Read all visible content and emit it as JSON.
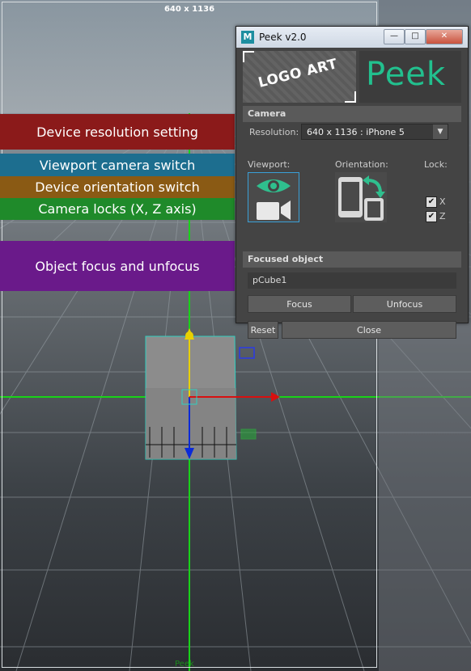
{
  "viewport": {
    "resolution_label": "640 x 1136",
    "bottom_label": "Peek",
    "object_name": "pCube1"
  },
  "annotations": [
    {
      "text": "Device resolution setting",
      "color": "#8b1a1a"
    },
    {
      "text": "Viewport camera switch",
      "color": "#1d6e8f"
    },
    {
      "text": "Device orientation switch",
      "color": "#8a5a14"
    },
    {
      "text": "Camera locks (X, Z axis)",
      "color": "#1f8a2a"
    },
    {
      "text": "Object focus and unfocus",
      "color": "#6a1a8a"
    }
  ],
  "window": {
    "title": "Peek v2.0",
    "app_icon": "M",
    "minimize_symbol": "—",
    "maximize_symbol": "□",
    "close_symbol": "✕",
    "logo_art_text": "LOGO ART",
    "logo_text": "Peek",
    "brand_color": "#22c08e",
    "camera_section": "Camera",
    "resolution_label": "Resolution:",
    "resolution_value": "640 x 1136 : iPhone 5",
    "viewport_label": "Viewport:",
    "orientation_label": "Orientation:",
    "lock_label": "Lock:",
    "lock_x_label": "X",
    "lock_z_label": "Z",
    "lock_x_checked": true,
    "lock_z_checked": true,
    "focused_section": "Focused object",
    "focused_value": "pCube1",
    "focus_button": "Focus",
    "unfocus_button": "Unfocus",
    "reset_button": "Reset",
    "close_button": "Close"
  }
}
